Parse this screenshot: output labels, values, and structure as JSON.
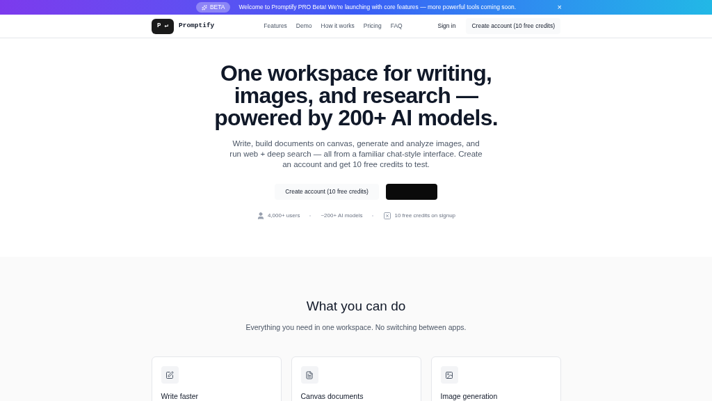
{
  "banner": {
    "badge": "BETA",
    "message": "Welcome to Promptify PRO Beta! We're launching with core features — more powerful tools coming soon.",
    "close": "×"
  },
  "nav": {
    "logo_mark": "P ↵",
    "brand": "Promptify",
    "links": [
      "Features",
      "Demo",
      "How it works",
      "Pricing",
      "FAQ"
    ],
    "sign_in": "Sign in",
    "cta": "Create account (10 free credits)"
  },
  "hero": {
    "title": "One workspace for writing, images, and research — powered by 200+ AI models.",
    "subtitle": "Write, build documents on canvas, generate and analyze images, and run web + deep search — all from a familiar chat-style interface. Create an account and get 10 free credits to test.",
    "primary": "Create account (10 free credits)",
    "stats": [
      {
        "kind": "user",
        "text": "4,000+ users"
      },
      {
        "kind": "none",
        "text": "~200+ AI models"
      },
      {
        "kind": "credit",
        "text": "10 free credits on signup"
      }
    ]
  },
  "features": {
    "title": "What you can do",
    "subtitle": "Everything you need in one workspace. No switching between apps.",
    "cards": [
      {
        "kind": "edit",
        "title": "Write faster"
      },
      {
        "kind": "doc",
        "title": "Canvas documents"
      },
      {
        "kind": "image",
        "title": "Image generation"
      }
    ]
  }
}
